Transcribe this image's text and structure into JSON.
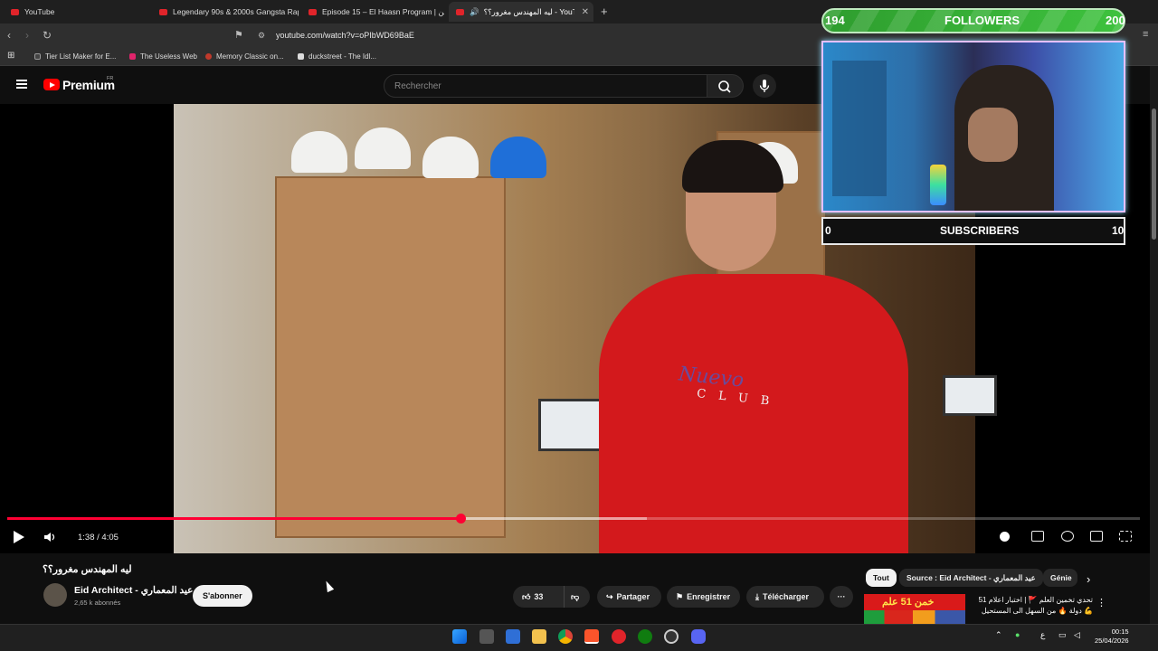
{
  "browser": {
    "tabs": [
      {
        "title": "YouTube",
        "active": false
      },
      {
        "title": "Legendary 90s & 2000s Gangsta Rap",
        "active": false
      },
      {
        "title": "Episode 15 – El Haasn Program | خمن",
        "active": false
      },
      {
        "title": "ليه المهندس مغرور؟؟ - YouTube",
        "active": true
      }
    ],
    "url": "youtube.com/watch?v=oPIbWD69BaE",
    "bookmarks": [
      "Tier List Maker for E...",
      "The Useless Web",
      "Memory Classic on...",
      "duckstreet - The Idl..."
    ]
  },
  "youtube": {
    "logo_text": "Premium",
    "region": "FR",
    "search_placeholder": "Rechercher",
    "player": {
      "time": "1:38 / 4:05",
      "progress": 0.4,
      "buffered": 0.565
    },
    "video": {
      "title": "ليه المهندس مغرور؟؟",
      "overlay_text_1": "Nuevo",
      "overlay_text_2": "CLUB"
    },
    "channel": {
      "name": "Eid Architect - عيد المعماري",
      "subscribers": "2,65 k abonnés",
      "subscribe_label": "S'abonner"
    },
    "actions": {
      "likes": "33",
      "share": "Partager",
      "save": "Enregistrer",
      "download": "Télécharger",
      "more": "···"
    },
    "chips": [
      "Tout",
      "Source : Eid Architect - عيد المعماري",
      "Génie"
    ],
    "recommendation": {
      "thumb_text": "خمن 51 علم",
      "title": "تحدي تخمين العلم 🚩 | اختبار اعلام 51 دولة 🔥 من السهل الى المستحيل 💪"
    }
  },
  "overlay": {
    "followers": {
      "label": "FOLLOWERS",
      "min": "194",
      "max": "200"
    },
    "subscribers": {
      "label": "SUBSCRIBERS",
      "min": "0",
      "max": "10"
    }
  },
  "taskbar": {
    "time": "00:15",
    "date": "25/04/2026",
    "lang": "ع"
  },
  "colors": {
    "accent": "#ff0033",
    "followers_bar": "#3ec23e"
  }
}
